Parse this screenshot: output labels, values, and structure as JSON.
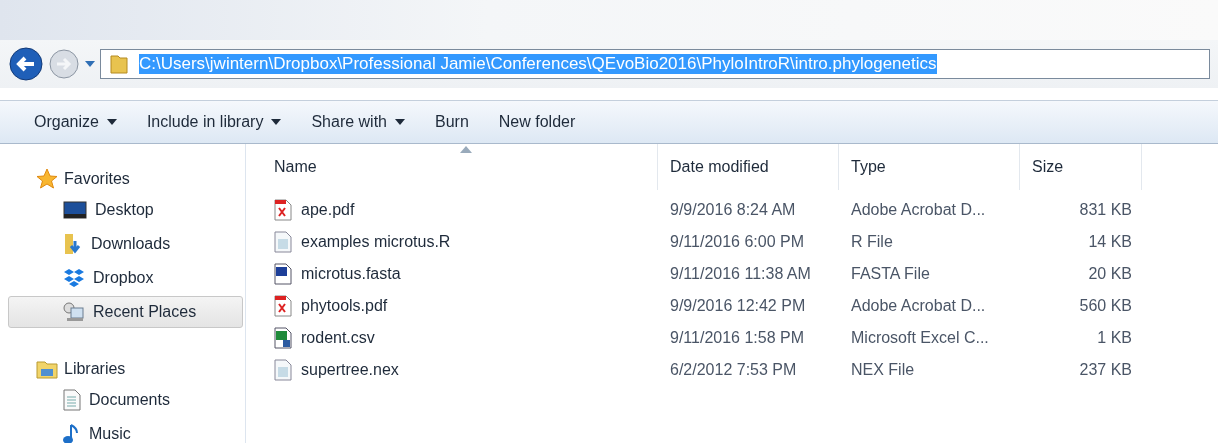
{
  "address_bar": {
    "path": "C:\\Users\\jwintern\\Dropbox\\Professional Jamie\\Conferences\\QEvoBio2016\\PhyloIntroR\\intro.phylogenetics",
    "selected": true
  },
  "toolbar": [
    {
      "label": "Organize",
      "dropdown": true
    },
    {
      "label": "Include in library",
      "dropdown": true
    },
    {
      "label": "Share with",
      "dropdown": true
    },
    {
      "label": "Burn",
      "dropdown": false
    },
    {
      "label": "New folder",
      "dropdown": false
    }
  ],
  "sidebar": {
    "groups": [
      {
        "label": "Favorites",
        "kind": "favorites",
        "items": [
          {
            "label": "Desktop",
            "kind": "desktop",
            "selected": false
          },
          {
            "label": "Downloads",
            "kind": "downloads",
            "selected": false
          },
          {
            "label": "Dropbox",
            "kind": "dropbox",
            "selected": false
          },
          {
            "label": "Recent Places",
            "kind": "recent",
            "selected": true
          }
        ]
      },
      {
        "label": "Libraries",
        "kind": "libraries",
        "items": [
          {
            "label": "Documents",
            "kind": "documents",
            "selected": false
          },
          {
            "label": "Music",
            "kind": "music",
            "selected": false
          }
        ]
      }
    ]
  },
  "table": {
    "columns": [
      {
        "label": "Name",
        "sorted": true
      },
      {
        "label": "Date modified",
        "sorted": false
      },
      {
        "label": "Type",
        "sorted": false
      },
      {
        "label": "Size",
        "sorted": false
      }
    ],
    "rows": [
      {
        "name": "ape.pdf",
        "kind": "pdf",
        "date": "9/9/2016 8:24 AM",
        "type": "Adobe Acrobat D...",
        "size": "831 KB"
      },
      {
        "name": "examples microtus.R",
        "kind": "text",
        "date": "9/11/2016 6:00 PM",
        "type": "R File",
        "size": "14 KB"
      },
      {
        "name": "microtus.fasta",
        "kind": "word",
        "date": "9/11/2016 11:38 AM",
        "type": "FASTA File",
        "size": "20 KB"
      },
      {
        "name": "phytools.pdf",
        "kind": "pdf",
        "date": "9/9/2016 12:42 PM",
        "type": "Adobe Acrobat D...",
        "size": "560 KB"
      },
      {
        "name": "rodent.csv",
        "kind": "excel",
        "date": "9/11/2016 1:58 PM",
        "type": "Microsoft Excel C...",
        "size": "1 KB"
      },
      {
        "name": "supertree.nex",
        "kind": "text",
        "date": "6/2/2012 7:53 PM",
        "type": "NEX File",
        "size": "237 KB"
      }
    ]
  }
}
